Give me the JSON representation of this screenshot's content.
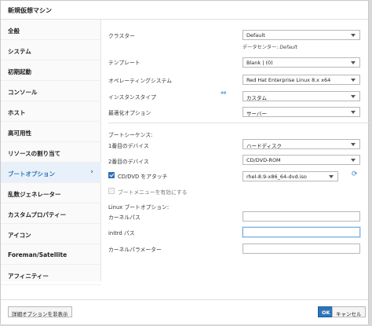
{
  "dialog": {
    "title": "新規仮想マシン"
  },
  "sidebar": {
    "items": [
      {
        "label": "全般"
      },
      {
        "label": "システム"
      },
      {
        "label": "初期起動"
      },
      {
        "label": "コンソール"
      },
      {
        "label": "ホスト"
      },
      {
        "label": "高可用性"
      },
      {
        "label": "リソースの割り当て"
      },
      {
        "label": "ブートオプション"
      },
      {
        "label": "乱数ジェネレーター"
      },
      {
        "label": "カスタムプロパティー"
      },
      {
        "label": "アイコン"
      },
      {
        "label": "Foreman/Satellite"
      },
      {
        "label": "アフィニティー"
      }
    ],
    "active_index": 7
  },
  "form": {
    "cluster": {
      "label": "クラスター",
      "value": "Default",
      "note_prefix": "データセンター: ",
      "note_value": "Default"
    },
    "template": {
      "label": "テンプレート",
      "value": "Blank | (0)"
    },
    "os": {
      "label": "オペレーティングシステム",
      "value": "Red Hat Enterprise Linux 8.x x64"
    },
    "instance_type": {
      "label": "インスタンスタイプ",
      "value": "カスタム"
    },
    "optimization": {
      "label": "最適化オプション",
      "value": "サーバー"
    },
    "boot_sequence": {
      "title": "ブートシーケンス:",
      "first_device": {
        "label": "1番目のデバイス",
        "value": "ハードディスク"
      },
      "second_device": {
        "label": "2番目のデバイス",
        "value": "CD/DVD-ROM"
      }
    },
    "attach_cd": {
      "label": "CD/DVD をアタッチ",
      "checked": true,
      "value": "rhel-8.9-x86_64-dvd.iso"
    },
    "boot_menu": {
      "label": "ブートメニューを有効にする",
      "checked": false
    },
    "linux_boot": {
      "title": "Linux ブートオプション:",
      "kernel_path": {
        "label": "カーネルパス",
        "value": ""
      },
      "initrd_path": {
        "label": "initrd パス",
        "value": ""
      },
      "kernel_params": {
        "label": "カーネルパラメーター",
        "value": ""
      }
    }
  },
  "footer": {
    "advanced_label": "詳細オプションを非表示",
    "ok_label": "OK",
    "cancel_label": "キャンセル"
  },
  "colors": {
    "accent": "#2e73b8",
    "active_bg": "#e8f1f9"
  }
}
